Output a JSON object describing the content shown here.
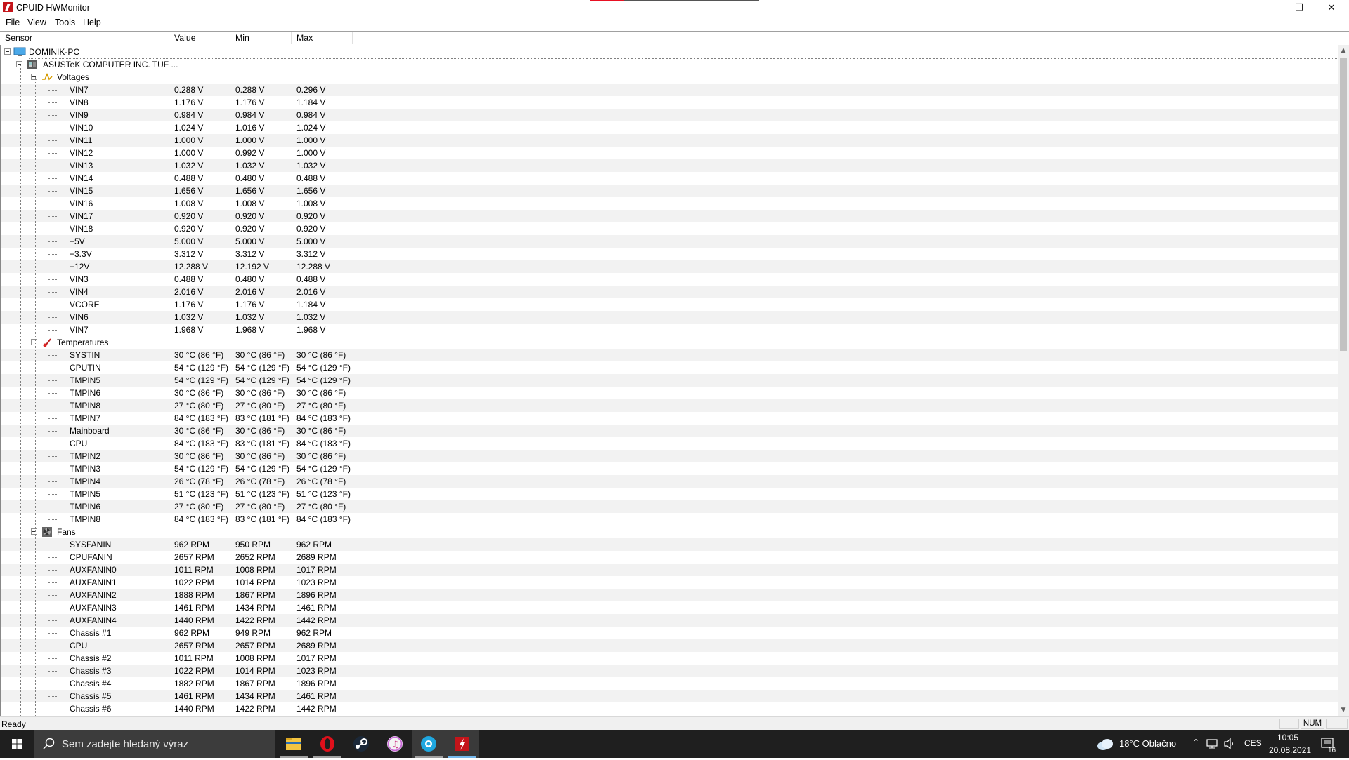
{
  "window": {
    "title": "CPUID HWMonitor",
    "controls": {
      "minimize": "—",
      "maximize": "❐",
      "close": "✕"
    }
  },
  "menu": [
    "File",
    "View",
    "Tools",
    "Help"
  ],
  "columns": {
    "sensor": "Sensor",
    "value": "Value",
    "min": "Min",
    "max": "Max"
  },
  "tree": {
    "computer": "DOMINIK-PC",
    "board": "ASUSTeK COMPUTER INC. TUF ...",
    "groups": [
      {
        "name": "Voltages",
        "icon": "voltage-icon",
        "rows": [
          [
            "VIN7",
            "0.288 V",
            "0.288 V",
            "0.296 V"
          ],
          [
            "VIN8",
            "1.176 V",
            "1.176 V",
            "1.184 V"
          ],
          [
            "VIN9",
            "0.984 V",
            "0.984 V",
            "0.984 V"
          ],
          [
            "VIN10",
            "1.024 V",
            "1.016 V",
            "1.024 V"
          ],
          [
            "VIN11",
            "1.000 V",
            "1.000 V",
            "1.000 V"
          ],
          [
            "VIN12",
            "1.000 V",
            "0.992 V",
            "1.000 V"
          ],
          [
            "VIN13",
            "1.032 V",
            "1.032 V",
            "1.032 V"
          ],
          [
            "VIN14",
            "0.488 V",
            "0.480 V",
            "0.488 V"
          ],
          [
            "VIN15",
            "1.656 V",
            "1.656 V",
            "1.656 V"
          ],
          [
            "VIN16",
            "1.008 V",
            "1.008 V",
            "1.008 V"
          ],
          [
            "VIN17",
            "0.920 V",
            "0.920 V",
            "0.920 V"
          ],
          [
            "VIN18",
            "0.920 V",
            "0.920 V",
            "0.920 V"
          ],
          [
            "+5V",
            "5.000 V",
            "5.000 V",
            "5.000 V"
          ],
          [
            "+3.3V",
            "3.312 V",
            "3.312 V",
            "3.312 V"
          ],
          [
            "+12V",
            "12.288 V",
            "12.192 V",
            "12.288 V"
          ],
          [
            "VIN3",
            "0.488 V",
            "0.480 V",
            "0.488 V"
          ],
          [
            "VIN4",
            "2.016 V",
            "2.016 V",
            "2.016 V"
          ],
          [
            "VCORE",
            "1.176 V",
            "1.176 V",
            "1.184 V"
          ],
          [
            "VIN6",
            "1.032 V",
            "1.032 V",
            "1.032 V"
          ],
          [
            "VIN7",
            "1.968 V",
            "1.968 V",
            "1.968 V"
          ]
        ]
      },
      {
        "name": "Temperatures",
        "icon": "thermometer-icon",
        "rows": [
          [
            "SYSTIN",
            "30 °C  (86 °F)",
            "30 °C  (86 °F)",
            "30 °C  (86 °F)"
          ],
          [
            "CPUTIN",
            "54 °C  (129 °F)",
            "54 °C  (129 °F)",
            "54 °C  (129 °F)"
          ],
          [
            "TMPIN5",
            "54 °C  (129 °F)",
            "54 °C  (129 °F)",
            "54 °C  (129 °F)"
          ],
          [
            "TMPIN6",
            "30 °C  (86 °F)",
            "30 °C  (86 °F)",
            "30 °C  (86 °F)"
          ],
          [
            "TMPIN8",
            "27 °C  (80 °F)",
            "27 °C  (80 °F)",
            "27 °C  (80 °F)"
          ],
          [
            "TMPIN7",
            "84 °C  (183 °F)",
            "83 °C  (181 °F)",
            "84 °C  (183 °F)"
          ],
          [
            "Mainboard",
            "30 °C  (86 °F)",
            "30 °C  (86 °F)",
            "30 °C  (86 °F)"
          ],
          [
            "CPU",
            "84 °C  (183 °F)",
            "83 °C  (181 °F)",
            "84 °C  (183 °F)"
          ],
          [
            "TMPIN2",
            "30 °C  (86 °F)",
            "30 °C  (86 °F)",
            "30 °C  (86 °F)"
          ],
          [
            "TMPIN3",
            "54 °C  (129 °F)",
            "54 °C  (129 °F)",
            "54 °C  (129 °F)"
          ],
          [
            "TMPIN4",
            "26 °C  (78 °F)",
            "26 °C  (78 °F)",
            "26 °C  (78 °F)"
          ],
          [
            "TMPIN5",
            "51 °C  (123 °F)",
            "51 °C  (123 °F)",
            "51 °C  (123 °F)"
          ],
          [
            "TMPIN6",
            "27 °C  (80 °F)",
            "27 °C  (80 °F)",
            "27 °C  (80 °F)"
          ],
          [
            "TMPIN8",
            "84 °C  (183 °F)",
            "83 °C  (181 °F)",
            "84 °C  (183 °F)"
          ]
        ]
      },
      {
        "name": "Fans",
        "icon": "fan-icon",
        "rows": [
          [
            "SYSFANIN",
            "962 RPM",
            "950 RPM",
            "962 RPM"
          ],
          [
            "CPUFANIN",
            "2657 RPM",
            "2652 RPM",
            "2689 RPM"
          ],
          [
            "AUXFANIN0",
            "1011 RPM",
            "1008 RPM",
            "1017 RPM"
          ],
          [
            "AUXFANIN1",
            "1022 RPM",
            "1014 RPM",
            "1023 RPM"
          ],
          [
            "AUXFANIN2",
            "1888 RPM",
            "1867 RPM",
            "1896 RPM"
          ],
          [
            "AUXFANIN3",
            "1461 RPM",
            "1434 RPM",
            "1461 RPM"
          ],
          [
            "AUXFANIN4",
            "1440 RPM",
            "1422 RPM",
            "1442 RPM"
          ],
          [
            "Chassis #1",
            "962 RPM",
            "949 RPM",
            "962 RPM"
          ],
          [
            "CPU",
            "2657 RPM",
            "2657 RPM",
            "2689 RPM"
          ],
          [
            "Chassis #2",
            "1011 RPM",
            "1008 RPM",
            "1017 RPM"
          ],
          [
            "Chassis #3",
            "1022 RPM",
            "1014 RPM",
            "1023 RPM"
          ],
          [
            "Chassis #4",
            "1882 RPM",
            "1867 RPM",
            "1896 RPM"
          ],
          [
            "Chassis #5",
            "1461 RPM",
            "1434 RPM",
            "1461 RPM"
          ],
          [
            "Chassis #6",
            "1440 RPM",
            "1422 RPM",
            "1442 RPM"
          ]
        ]
      }
    ]
  },
  "status": {
    "text": "Ready",
    "num": "NUM"
  },
  "taskbar": {
    "search_placeholder": "Sem zadejte hledaný výraz",
    "apps": [
      "file-explorer-icon",
      "opera-icon",
      "steam-icon",
      "itunes-icon",
      "app-icon",
      "hwmonitor-icon"
    ],
    "weather": "18°C  Oblačno",
    "language": "CES",
    "time": "10:05",
    "date": "20.08.2021",
    "notifications": "16"
  }
}
